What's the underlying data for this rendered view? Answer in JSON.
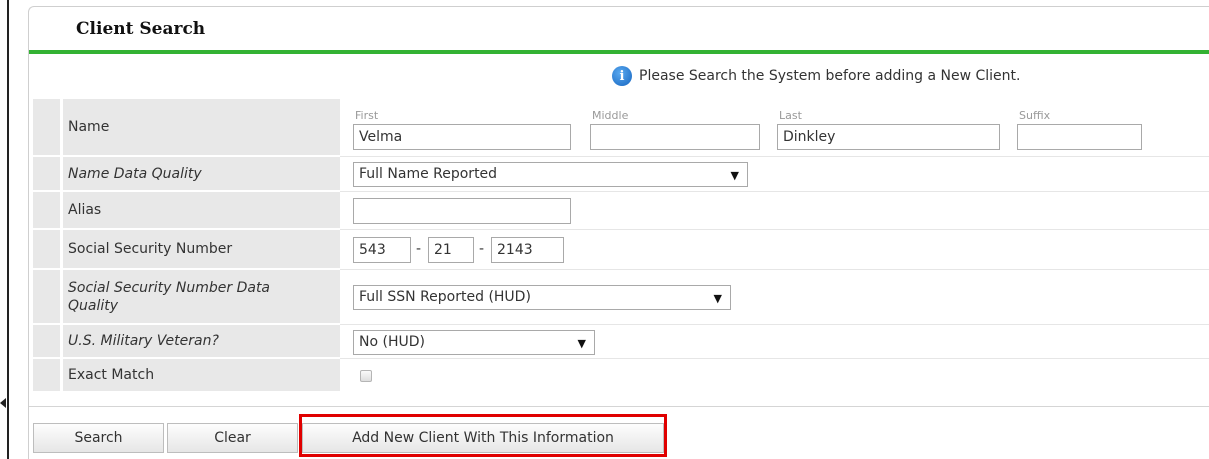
{
  "panel": {
    "title": "Client Search"
  },
  "notice": {
    "text": "Please Search the System before adding a New Client.",
    "icon": "info-icon",
    "color": "#1565c0"
  },
  "name_row": {
    "label": "Name",
    "first": {
      "label": "First",
      "value": "Velma"
    },
    "middle": {
      "label": "Middle",
      "value": ""
    },
    "last": {
      "label": "Last",
      "value": "Dinkley"
    },
    "suffix": {
      "label": "Suffix",
      "value": ""
    }
  },
  "name_quality": {
    "label": "Name Data Quality",
    "value": "Full Name Reported"
  },
  "alias": {
    "label": "Alias",
    "value": ""
  },
  "ssn": {
    "label": "Social Security Number",
    "part1": "543",
    "part2": "21",
    "part3": "2143",
    "separator": "-"
  },
  "ssn_quality": {
    "label": "Social Security Number Data Quality",
    "value": "Full SSN Reported (HUD)"
  },
  "veteran": {
    "label": "U.S. Military Veteran?",
    "value": "No (HUD)"
  },
  "exact_match": {
    "label": "Exact Match",
    "checked": false
  },
  "buttons": {
    "search": "Search",
    "clear": "Clear",
    "add_new": "Add New Client With This Information"
  },
  "colors": {
    "accent_bar": "#33b233",
    "highlight": "#e00000"
  }
}
